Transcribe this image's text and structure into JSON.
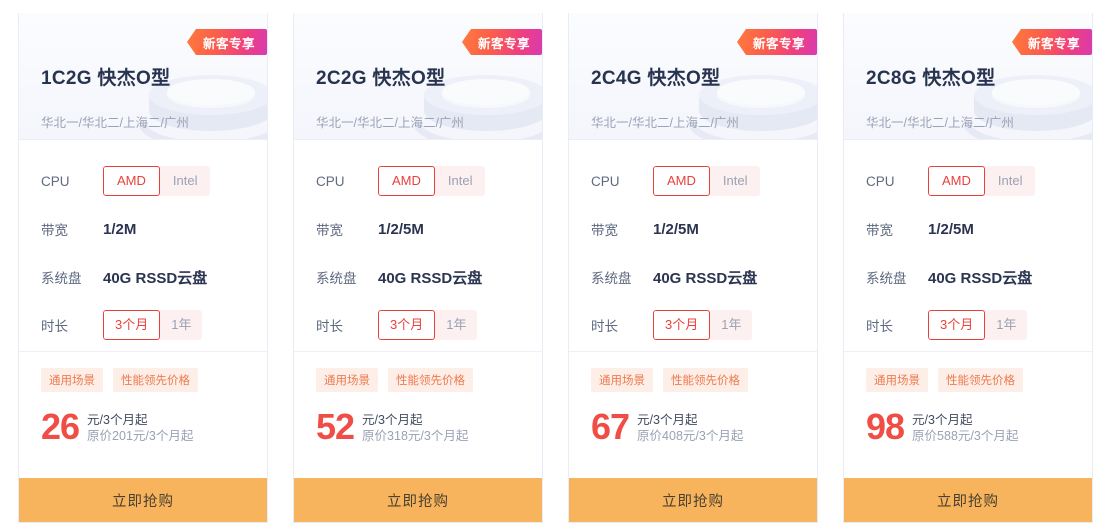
{
  "badge_label": "新客专享",
  "buy_label": "立即抢购",
  "labels": {
    "cpu": "CPU",
    "bandwidth": "带宽",
    "disk": "系统盘",
    "duration": "时长"
  },
  "colors": {
    "accent_red": "#e8413c",
    "price_red": "#ef4d45",
    "button_orange": "#f7b45c",
    "tag_orange": "#f07a4e",
    "title_navy": "#283350",
    "top_tab": "#ec5b4f"
  },
  "cards": [
    {
      "title": "1C2G 快杰O型",
      "regions": "华北一/华北二/上海二/广州",
      "cpu_options": [
        {
          "label": "AMD",
          "selected": true
        },
        {
          "label": "Intel",
          "selected": false
        }
      ],
      "bandwidth": "1/2M",
      "disk": "40G RSSD云盘",
      "duration_options": [
        {
          "label": "3个月",
          "selected": true
        },
        {
          "label": "1年",
          "selected": false
        }
      ],
      "tags": [
        "通用场景",
        "性能领先价格"
      ],
      "price": "26",
      "price_unit": "元/3个月起",
      "price_original": "原价201元/3个月起"
    },
    {
      "title": "2C2G 快杰O型",
      "regions": "华北一/华北二/上海二/广州",
      "cpu_options": [
        {
          "label": "AMD",
          "selected": true
        },
        {
          "label": "Intel",
          "selected": false
        }
      ],
      "bandwidth": "1/2/5M",
      "disk": "40G RSSD云盘",
      "duration_options": [
        {
          "label": "3个月",
          "selected": true
        },
        {
          "label": "1年",
          "selected": false
        }
      ],
      "tags": [
        "通用场景",
        "性能领先价格"
      ],
      "price": "52",
      "price_unit": "元/3个月起",
      "price_original": "原价318元/3个月起"
    },
    {
      "title": "2C4G 快杰O型",
      "regions": "华北一/华北二/上海二/广州",
      "cpu_options": [
        {
          "label": "AMD",
          "selected": true
        },
        {
          "label": "Intel",
          "selected": false
        }
      ],
      "bandwidth": "1/2/5M",
      "disk": "40G RSSD云盘",
      "duration_options": [
        {
          "label": "3个月",
          "selected": true
        },
        {
          "label": "1年",
          "selected": false
        }
      ],
      "tags": [
        "通用场景",
        "性能领先价格"
      ],
      "price": "67",
      "price_unit": "元/3个月起",
      "price_original": "原价408元/3个月起"
    },
    {
      "title": "2C8G 快杰O型",
      "regions": "华北一/华北二/上海二/广州",
      "cpu_options": [
        {
          "label": "AMD",
          "selected": true
        },
        {
          "label": "Intel",
          "selected": false
        }
      ],
      "bandwidth": "1/2/5M",
      "disk": "40G RSSD云盘",
      "duration_options": [
        {
          "label": "3个月",
          "selected": true
        },
        {
          "label": "1年",
          "selected": false
        }
      ],
      "tags": [
        "通用场景",
        "性能领先价格"
      ],
      "price": "98",
      "price_unit": "元/3个月起",
      "price_original": "原价588元/3个月起"
    }
  ]
}
